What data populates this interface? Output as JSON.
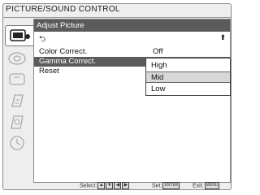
{
  "window": {
    "title": "PICTURE/SOUND CONTROL"
  },
  "sidebar": {
    "icons": [
      {
        "name": "picture-control-icon",
        "active": true
      },
      {
        "name": "sound-control-icon",
        "active": false
      },
      {
        "name": "display-setting-icon",
        "active": false
      },
      {
        "name": "setup-icon",
        "active": false
      },
      {
        "name": "security-icon",
        "active": false
      },
      {
        "name": "timer-icon",
        "active": false
      }
    ]
  },
  "panel": {
    "header": "Adjust Picture",
    "back_symbol": "⮌",
    "scroll_up_symbol": "⬆",
    "rows": [
      {
        "label": "Color Correct.",
        "value": "Off"
      },
      {
        "label": "Gamma Correct.",
        "value": ""
      },
      {
        "label": "Reset",
        "value": ""
      }
    ],
    "dropdown": {
      "options": [
        "High",
        "Mid",
        "Low"
      ],
      "selected": "Mid"
    }
  },
  "footer": {
    "select_label": "Select:",
    "set_label": "Set:",
    "set_key": "ENTER",
    "exit_label": "Exit:",
    "exit_key": "MENU"
  }
}
